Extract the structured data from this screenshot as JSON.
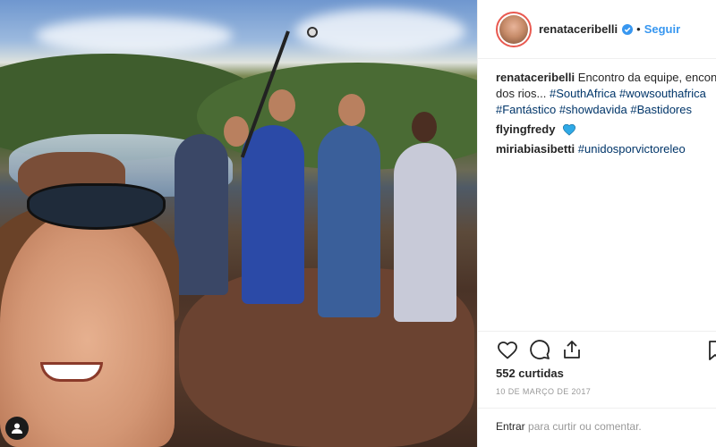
{
  "post": {
    "photo_alt": "",
    "username": "renataceribelli",
    "follow_label": "Seguir",
    "separator": "•",
    "caption": {
      "user": "renataceribelli",
      "text_line1": "Encontro da equipe, encontro",
      "text_line2_prefix": "dos rios...",
      "tags_line2": [
        "#SouthAfrica",
        "#wowsouthafrica"
      ],
      "tags_line3": [
        "#Fantástico",
        "#showdavida",
        "#Bastidores"
      ]
    },
    "comments": [
      {
        "user": "flyingfredy",
        "text": "",
        "emoji": "blue-heart-icon"
      },
      {
        "user": "miriabiasibetti",
        "tag": "#unidosporvictoreleo"
      }
    ],
    "likes": "552 curtidas",
    "date": "10 DE MARÇO DE 2017",
    "login_prompt": {
      "link": "Entrar",
      "rest": "para curtir ou comentar."
    }
  },
  "colors": {
    "accent": "#3897f0",
    "tag": "#003569",
    "muted": "#999999",
    "text": "#262626"
  }
}
